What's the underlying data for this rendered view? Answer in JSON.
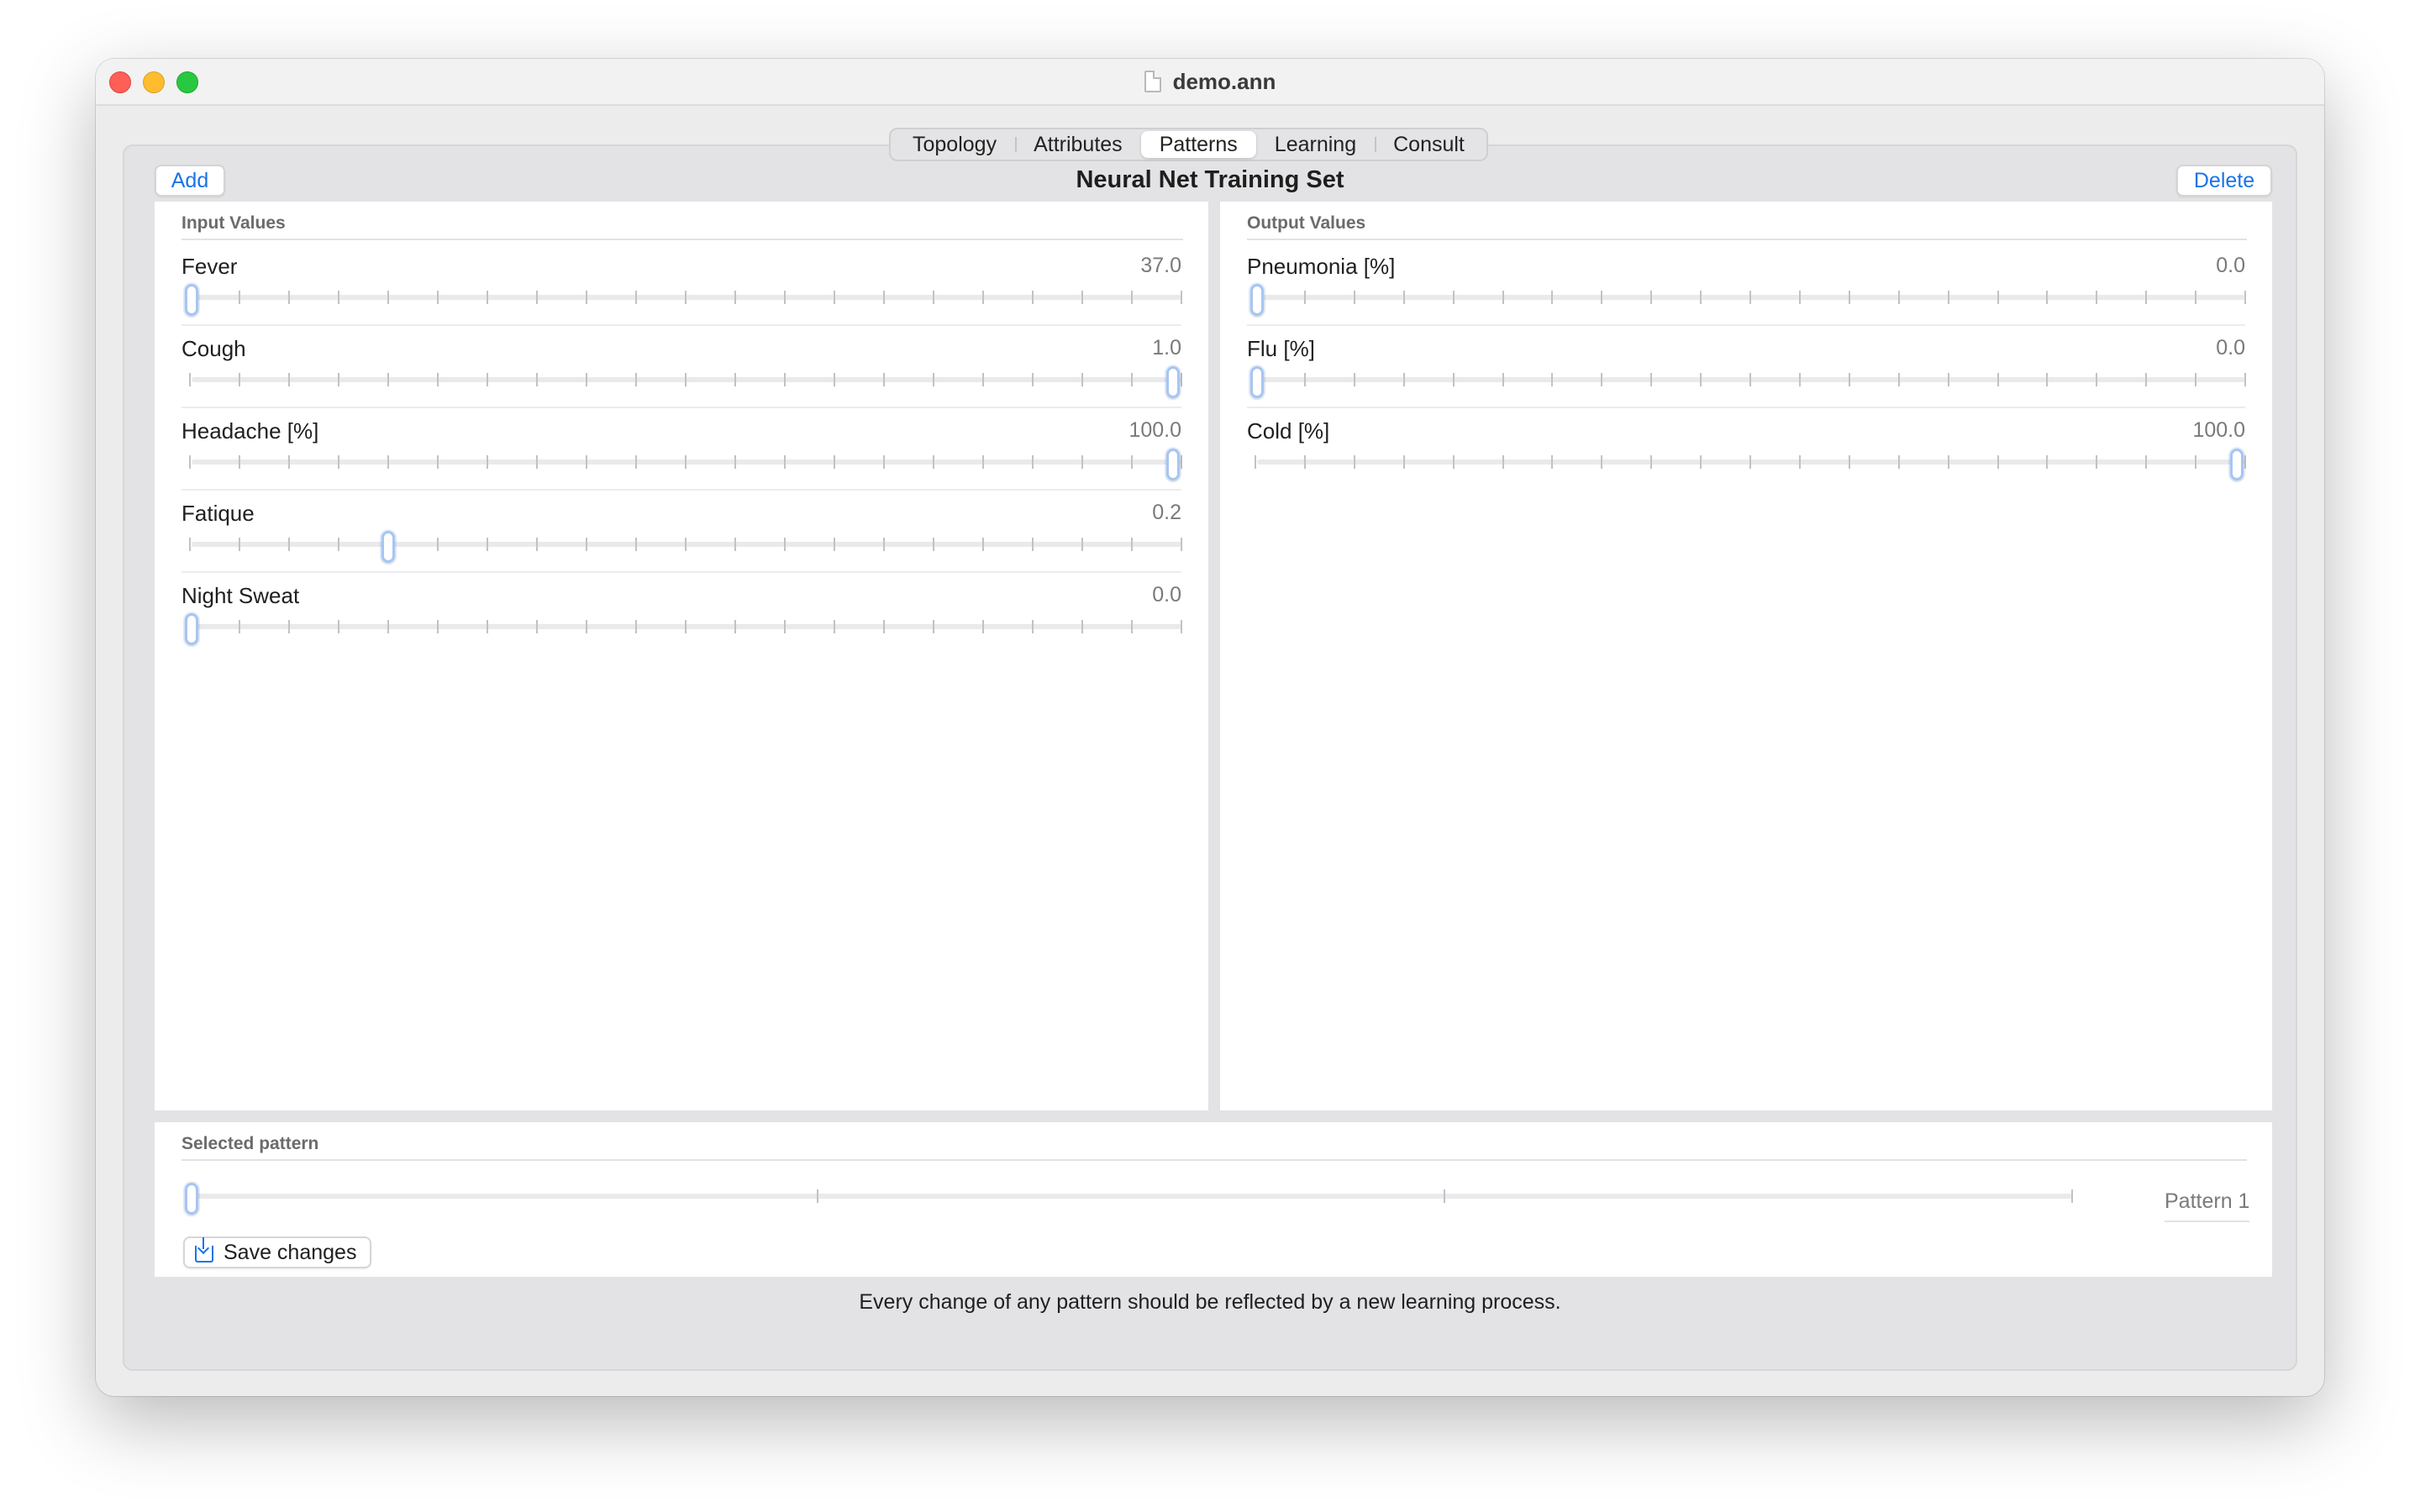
{
  "window": {
    "title": "demo.ann",
    "title_icon": "document-icon"
  },
  "tabs": [
    {
      "label": "Topology",
      "active": false
    },
    {
      "label": "Attributes",
      "active": false
    },
    {
      "label": "Patterns",
      "active": true
    },
    {
      "label": "Learning",
      "active": false
    },
    {
      "label": "Consult",
      "active": false
    }
  ],
  "toolbar": {
    "add_label": "Add",
    "title": "Neural Net Training Set",
    "delete_label": "Delete"
  },
  "inputs": {
    "header": "Input Values",
    "items": [
      {
        "label": "Fever",
        "value": "37.0",
        "fraction": 0.0
      },
      {
        "label": "Cough",
        "value": "1.0",
        "fraction": 1.0
      },
      {
        "label": "Headache [%]",
        "value": "100.0",
        "fraction": 1.0
      },
      {
        "label": "Fatique",
        "value": "0.2",
        "fraction": 0.2
      },
      {
        "label": "Night Sweat",
        "value": "0.0",
        "fraction": 0.0
      }
    ]
  },
  "outputs": {
    "header": "Output Values",
    "items": [
      {
        "label": "Pneumonia [%]",
        "value": "0.0",
        "fraction": 0.0
      },
      {
        "label": "Flu [%]",
        "value": "0.0",
        "fraction": 0.0
      },
      {
        "label": "Cold [%]",
        "value": "100.0",
        "fraction": 1.0
      }
    ]
  },
  "selected_pattern": {
    "header": "Selected pattern",
    "label": "Pattern 1",
    "fraction": 0.0,
    "save_label": "Save changes"
  },
  "footer": {
    "note": "Every change of any pattern should be reflected by a new learning process."
  },
  "colors": {
    "accent": "#1a73e8",
    "knob_border": "#a7c5f2",
    "window_bg": "#ececec"
  }
}
